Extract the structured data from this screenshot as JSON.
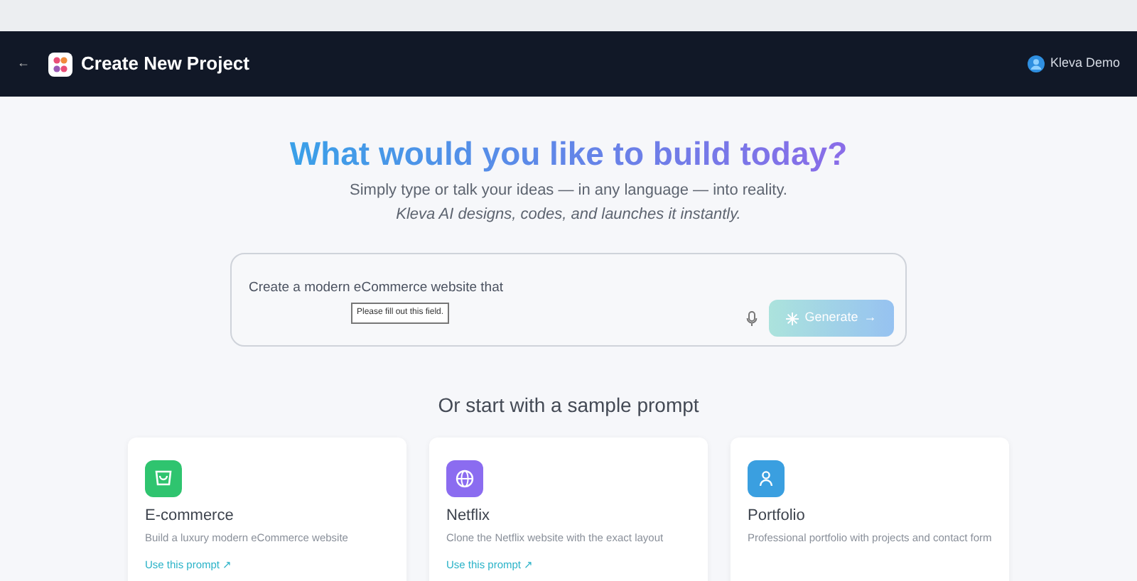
{
  "header": {
    "back": "←",
    "title": "Create New Project",
    "user": "Kleva Demo"
  },
  "hero": {
    "title": "What would you like to build today?",
    "subtitle": "Simply type or talk your ideas — in any language — into reality.",
    "tagline": "Kleva AI designs, codes, and launches it instantly."
  },
  "prompt": {
    "value": "Create a modern eCommerce website that",
    "tooltip": "Please fill out this field.",
    "generate": {
      "label": "Generate",
      "arrow": "→",
      "disabled": true
    }
  },
  "samples_heading": "Or start with a sample prompt",
  "samples": [
    {
      "kind": "cart",
      "title": "E-commerce",
      "description": "Build a luxury modern eCommerce website",
      "link": "Use this prompt ↗",
      "color": "#2fc46f"
    },
    {
      "kind": "globe",
      "title": "Netflix",
      "description": "Clone the Netflix website with the exact layout",
      "link": "Use this prompt ↗",
      "color": "#8b6cf0"
    },
    {
      "kind": "person",
      "title": "Portfolio",
      "description": "Professional portfolio with projects and contact form",
      "color": "#3a9fe0"
    }
  ]
}
